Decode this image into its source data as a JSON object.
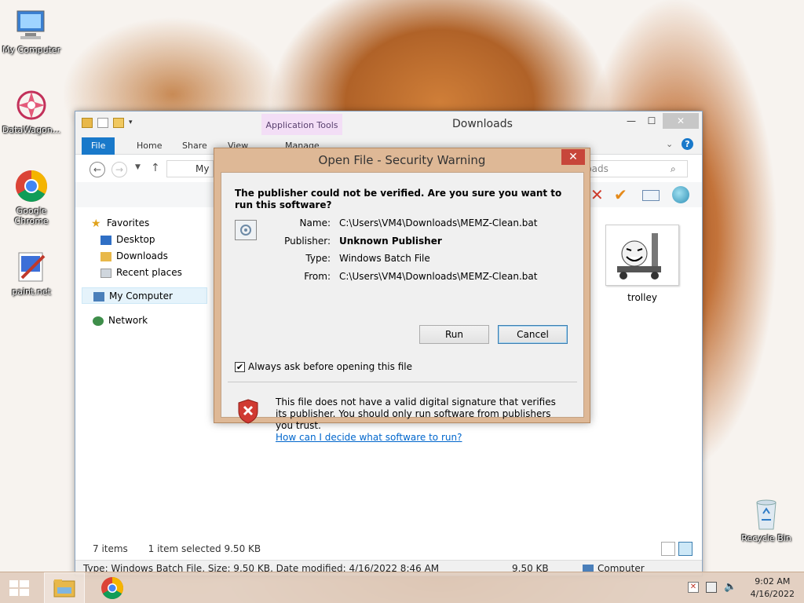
{
  "desktop": {
    "icons": [
      {
        "label": "My Computer",
        "icon": "my-computer-icon"
      },
      {
        "label": "DataWagon...",
        "icon": "datawagon-icon"
      },
      {
        "label": "Google Chrome",
        "icon": "chrome-icon"
      },
      {
        "label": "paint.net",
        "icon": "paint-net-icon"
      },
      {
        "label": "Recycle Bin",
        "icon": "recycle-bin-icon"
      }
    ]
  },
  "explorer": {
    "title": "Downloads",
    "contextual_tab": "Application Tools",
    "tabs": [
      "File",
      "Home",
      "Share",
      "View",
      "Manage"
    ],
    "address": "My",
    "search_placeholder": "loads",
    "nav": {
      "favorites": "Favorites",
      "desktop": "Desktop",
      "downloads": "Downloads",
      "recent": "Recent places",
      "computer": "My Computer",
      "network": "Network"
    },
    "file": {
      "name": "trolley"
    },
    "status": {
      "count": "7 items",
      "selected": "1 item selected  9.50 KB"
    },
    "details": {
      "info": "Type: Windows Batch File, Size: 9.50 KB, Date modified: 4/16/2022 8:46 AM",
      "size": "9.50 KB",
      "location": "Computer"
    }
  },
  "dialog": {
    "title": "Open File - Security Warning",
    "close": "✕",
    "heading": "The publisher could not be verified.  Are you sure you want to run this software?",
    "fields": {
      "name_label": "Name:",
      "name_value": "C:\\Users\\VM4\\Downloads\\MEMZ-Clean.bat",
      "publisher_label": "Publisher:",
      "publisher_value": "Unknown Publisher",
      "type_label": "Type:",
      "type_value": "Windows Batch File",
      "from_label": "From:",
      "from_value": "C:\\Users\\VM4\\Downloads\\MEMZ-Clean.bat"
    },
    "run": "Run",
    "cancel": "Cancel",
    "checkbox_label": "Always ask before opening this file",
    "checkbox_checked": true,
    "warning": "This file does not have a valid digital signature that verifies its publisher.  You should only run software from publishers you trust.",
    "link": "How can I decide what software to run?"
  },
  "taskbar": {
    "time": "9:02 AM",
    "date": "4/16/2022"
  },
  "colors": {
    "dialog_frame": "#deb896",
    "close_red": "#c7463a",
    "file_tab": "#1979ca",
    "link": "#0066cc",
    "app_tools": "#f3def6"
  }
}
